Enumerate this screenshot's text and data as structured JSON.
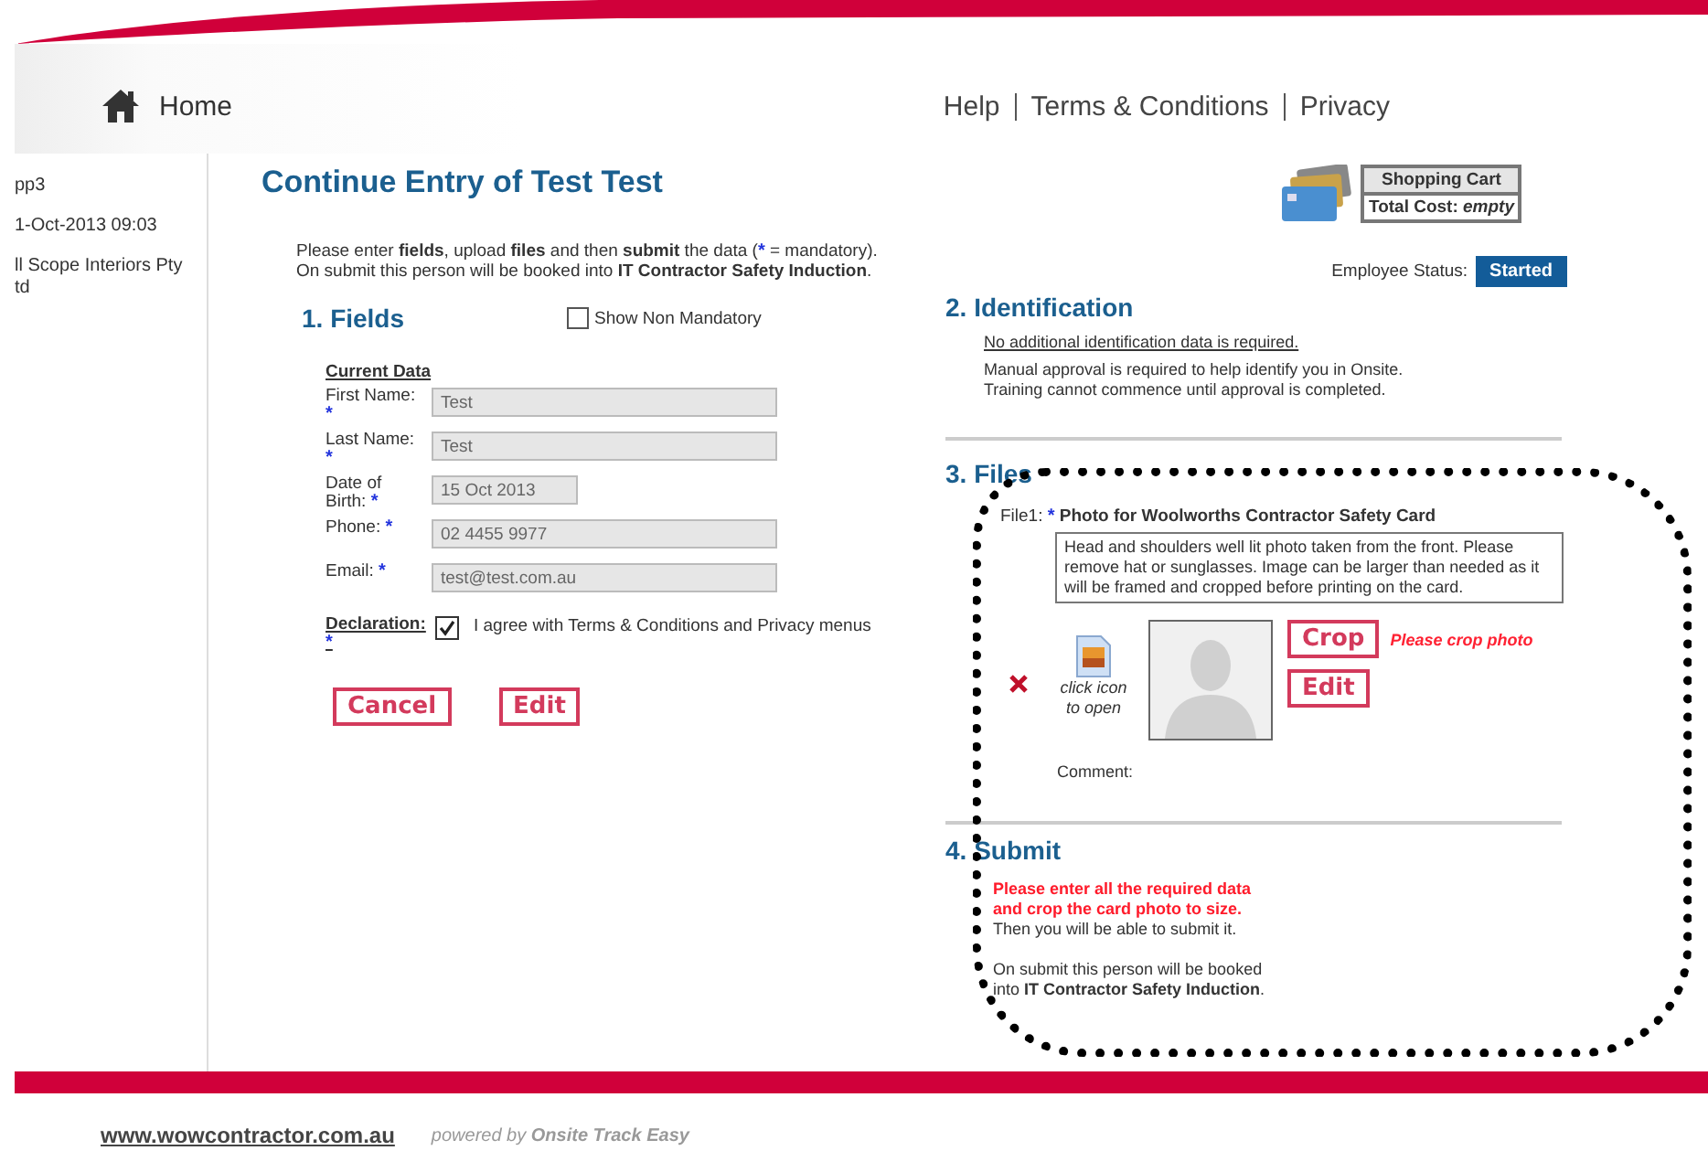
{
  "header": {
    "home": "Home",
    "links": [
      "Help",
      "Terms & Conditions",
      "Privacy"
    ]
  },
  "sidebar": {
    "lines": [
      "pp3",
      "1-Oct-2013 09:03",
      "ll Scope Interiors Pty",
      "td"
    ]
  },
  "title": "Continue Entry of Test Test",
  "intro": {
    "before": "Please enter **fields**, upload **files** and then **submit** the data (",
    "mark": "*",
    "after": " = mandatory).",
    "line2": "On submit this person will be booked into **IT Contractor Safety Induction**."
  },
  "cart": {
    "title": "Shopping Cart",
    "cost_label": "Total Cost:",
    "cost_value": "empty"
  },
  "status": {
    "label": "Employee Status:",
    "value": "Started"
  },
  "fields": {
    "heading": "1. Fields",
    "show_non_mandatory": {
      "label": "Show Non Mandatory",
      "checked": false
    },
    "subheading": "Current Data",
    "items": [
      {
        "label": "First Name:",
        "mark": "*",
        "value": "Test",
        "kind": "long"
      },
      {
        "label": "Last Name:",
        "mark": "*",
        "value": "Test",
        "kind": "long"
      },
      {
        "label": "Date of Birth:",
        "mark": "*",
        "value": "15 Oct 2013",
        "kind": "short"
      },
      {
        "label": "Phone:",
        "mark": "*",
        "value": "02 4455 9977",
        "kind": "long"
      },
      {
        "label": "Email:",
        "mark": "*",
        "value": "test@test.com.au",
        "kind": "long"
      }
    ],
    "declaration": {
      "label": "Declaration:",
      "mark": "*",
      "text": "I agree with Terms & Conditions and Privacy menus",
      "checked": true
    },
    "buttons": [
      "Cancel",
      "Edit"
    ]
  },
  "identification": {
    "heading": "2. Identification",
    "note": "No additional identification data is required.",
    "lines": [
      "Manual approval is required to help identify you in Onsite.",
      "Training cannot commence until approval is completed."
    ]
  },
  "files": {
    "heading": "3. Files",
    "file_label": "File1:",
    "mark": "*",
    "title": "Photo for Woolworths Contractor Safety Card",
    "hint": "Head and shoulders well lit photo taken from the front. Please remove hat or sunglasses. Image can be larger than needed as it will be framed and cropped before printing on the card.",
    "open_hint": "click icon to open",
    "crop_button": "Crop",
    "crop_warning": "Please crop photo",
    "edit_button": "Edit",
    "comment_label": "Comment:"
  },
  "submit": {
    "heading": "4. Submit",
    "warning": "Please enter all the required data and crop the card photo to size.",
    "then": "Then you will be able to submit it.",
    "booking": "On submit this person will be booked into **IT Contractor Safety Induction**."
  },
  "footer": {
    "site": "www.wowcontractor.com.au",
    "powered": "powered by **Onsite Track Easy**"
  }
}
